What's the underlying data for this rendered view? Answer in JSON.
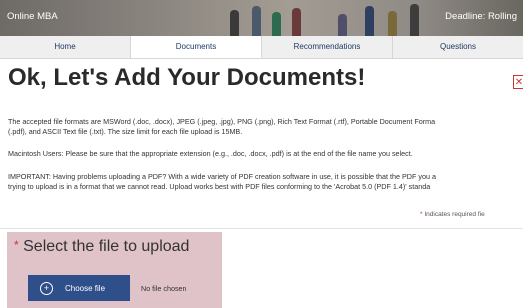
{
  "header": {
    "program_name": "Online MBA",
    "deadline": "Deadline: Rolling"
  },
  "tabs": [
    {
      "label": "Home"
    },
    {
      "label": "Documents"
    },
    {
      "label": "Recommendations"
    },
    {
      "label": "Questions"
    }
  ],
  "page": {
    "title": "Ok, Let's Add Your Documents!",
    "close_label": "✕",
    "paragraph1_line1": "The accepted file formats are MSWord (.doc, .docx), JPEG (.jpeg, .jpg), PNG (.png), Rich Text Format (.rtf), Portable Document Forma",
    "paragraph1_line2": "(.pdf), and ASCII Text file (.txt). The size limit for each file upload is 15MB.",
    "paragraph2": "Macintosh Users: Please be sure that the appropriate extension (e.g., .doc, .docx, .pdf) is at the end of the file name you select.",
    "paragraph3_line1": "IMPORTANT: Having problems uploading a PDF? With a wide variety of PDF creation software in use, it is possible that the PDF you a",
    "paragraph3_line2": "trying to upload is in a format that we cannot read. Upload works best with PDF files conforming to the 'Acrobat 5.0 (PDF 1.4)' standa",
    "required_star": "*",
    "required_note": " Indicates required fie"
  },
  "upload": {
    "required_star": "*",
    "title": " Select the file to upload",
    "button_label": "Choose file",
    "plus_icon": "+",
    "file_status": "No file chosen"
  }
}
